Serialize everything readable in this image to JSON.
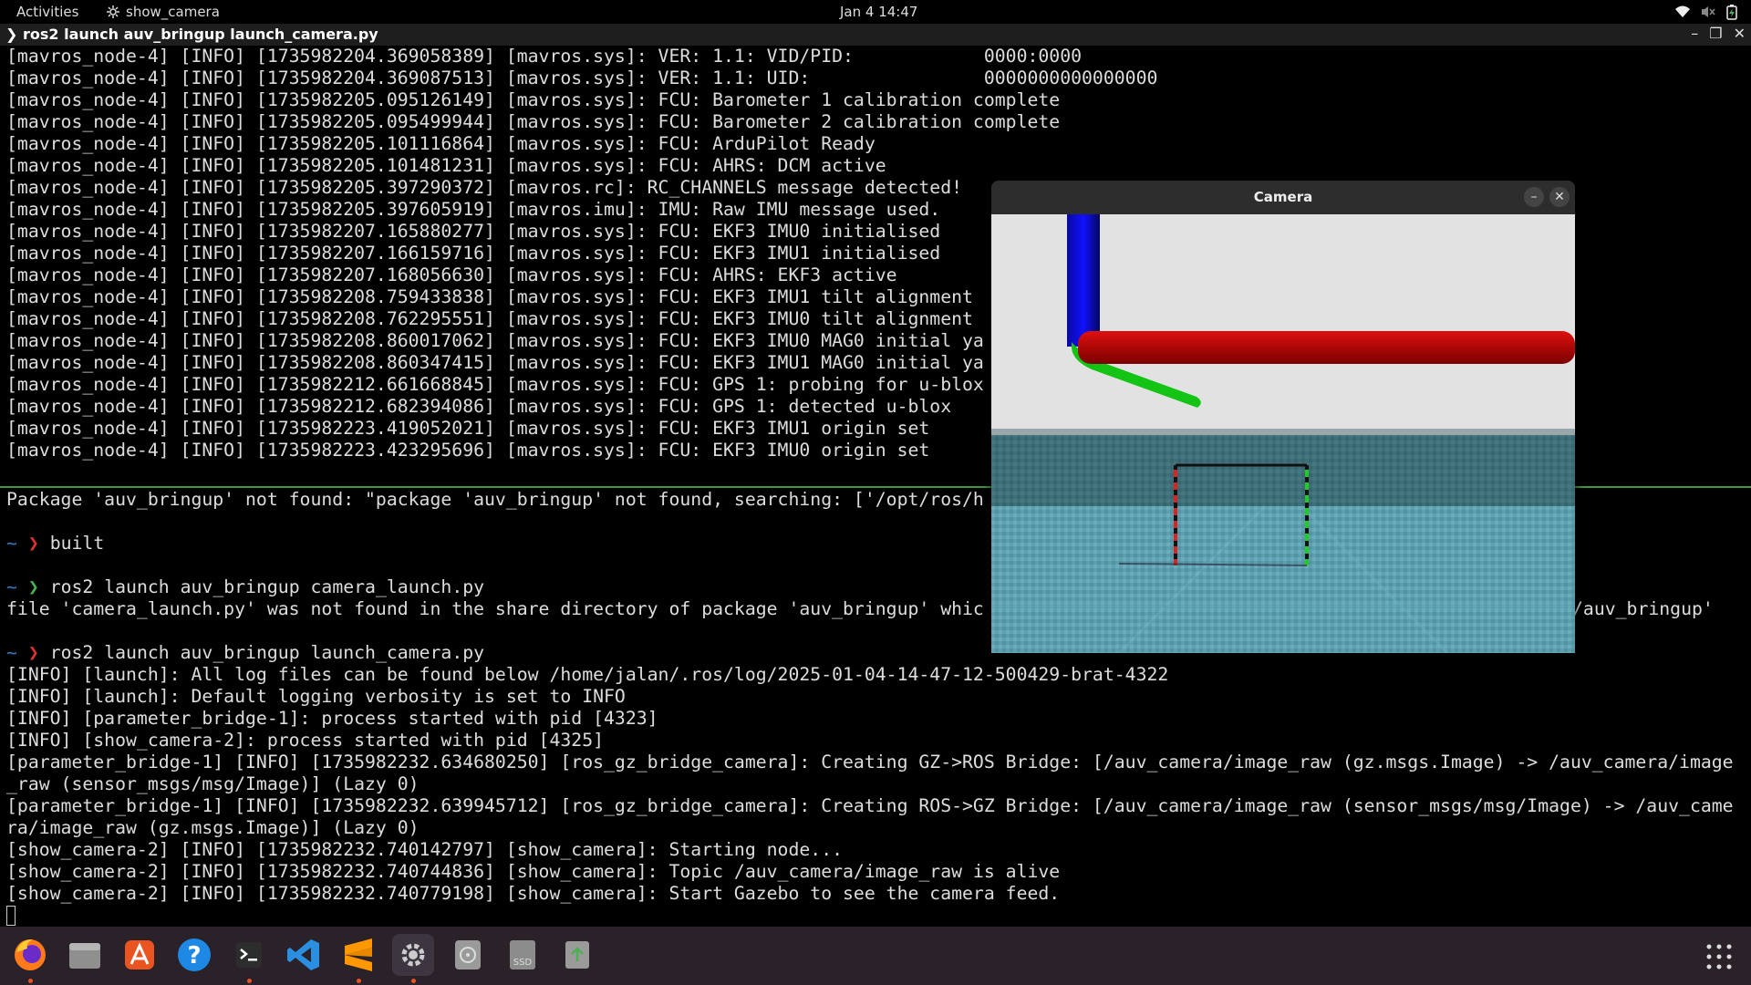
{
  "topbar": {
    "activities": "Activities",
    "app_name": "show_camera",
    "clock": "Jan 4  14:47"
  },
  "terminal": {
    "title": "ros2 launch auv_bringup launch_camera.py",
    "upper_lines": [
      "[mavros_node-4] [INFO] [1735982204.369058389] [mavros.sys]: VER: 1.1: VID/PID:            0000:0000",
      "[mavros_node-4] [INFO] [1735982204.369087513] [mavros.sys]: VER: 1.1: UID:                0000000000000000",
      "[mavros_node-4] [INFO] [1735982205.095126149] [mavros.sys]: FCU: Barometer 1 calibration complete",
      "[mavros_node-4] [INFO] [1735982205.095499944] [mavros.sys]: FCU: Barometer 2 calibration complete",
      "[mavros_node-4] [INFO] [1735982205.101116864] [mavros.sys]: FCU: ArduPilot Ready",
      "[mavros_node-4] [INFO] [1735982205.101481231] [mavros.sys]: FCU: AHRS: DCM active",
      "[mavros_node-4] [INFO] [1735982205.397290372] [mavros.rc]: RC_CHANNELS message detected!",
      "[mavros_node-4] [INFO] [1735982205.397605919] [mavros.imu]: IMU: Raw IMU message used.",
      "[mavros_node-4] [INFO] [1735982207.165880277] [mavros.sys]: FCU: EKF3 IMU0 initialised",
      "[mavros_node-4] [INFO] [1735982207.166159716] [mavros.sys]: FCU: EKF3 IMU1 initialised",
      "[mavros_node-4] [INFO] [1735982207.168056630] [mavros.sys]: FCU: AHRS: EKF3 active",
      "[mavros_node-4] [INFO] [1735982208.759433838] [mavros.sys]: FCU: EKF3 IMU1 tilt alignment",
      "[mavros_node-4] [INFO] [1735982208.762295551] [mavros.sys]: FCU: EKF3 IMU0 tilt alignment",
      "[mavros_node-4] [INFO] [1735982208.860017062] [mavros.sys]: FCU: EKF3 IMU0 MAG0 initial ya",
      "[mavros_node-4] [INFO] [1735982208.860347415] [mavros.sys]: FCU: EKF3 IMU1 MAG0 initial ya",
      "[mavros_node-4] [INFO] [1735982212.661668845] [mavros.sys]: FCU: GPS 1: probing for u-blox",
      "[mavros_node-4] [INFO] [1735982212.682394086] [mavros.sys]: FCU: GPS 1: detected u-blox",
      "[mavros_node-4] [INFO] [1735982223.419052021] [mavros.sys]: FCU: EKF3 IMU1 origin set",
      "[mavros_node-4] [INFO] [1735982223.423295696] [mavros.sys]: FCU: EKF3 IMU0 origin set"
    ],
    "package_error": "Package 'auv_bringup' not found: \"package 'auv_bringup' not found, searching: ['/opt/ros/h",
    "prompt_tilde": "~",
    "prompt_arrow": "❯",
    "cmd_built": "built",
    "cmd_camera_launch": "ros2 launch auv_bringup camera_launch.py",
    "file_error_left": "file 'camera_launch.py' was not found in the share directory of package 'auv_bringup' whic",
    "file_error_right": "/auv_bringup'",
    "cmd_launch_camera": "ros2 launch auv_bringup launch_camera.py",
    "lower_lines": [
      "[INFO] [launch]: All log files can be found below /home/jalan/.ros/log/2025-01-04-14-47-12-500429-brat-4322",
      "[INFO] [launch]: Default logging verbosity is set to INFO",
      "[INFO] [parameter_bridge-1]: process started with pid [4323]",
      "[INFO] [show_camera-2]: process started with pid [4325]",
      "[parameter_bridge-1] [INFO] [1735982232.634680250] [ros_gz_bridge_camera]: Creating GZ->ROS Bridge: [/auv_camera/image_raw (gz.msgs.Image) -> /auv_camera/image",
      "_raw (sensor_msgs/msg/Image)] (Lazy 0)",
      "[parameter_bridge-1] [INFO] [1735982232.639945712] [ros_gz_bridge_camera]: Creating ROS->GZ Bridge: [/auv_camera/image_raw (sensor_msgs/msg/Image) -> /auv_came",
      "ra/image_raw (gz.msgs.Image)] (Lazy 0)",
      "[show_camera-2] [INFO] [1735982232.740142797] [show_camera]: Starting node...",
      "[show_camera-2] [INFO] [1735982232.740744836] [show_camera]: Topic /auv_camera/image_raw is alive",
      "[show_camera-2] [INFO] [1735982232.740779198] [show_camera]: Start Gazebo to see the camera feed."
    ]
  },
  "camera_window": {
    "title": "Camera",
    "minimize": "–",
    "close": "✕"
  },
  "dock": {
    "items": [
      "firefox-icon",
      "files-icon",
      "app-center-icon",
      "help-icon",
      "terminal-icon",
      "vscode-icon",
      "sublime-icon",
      "settings-icon",
      "disks-icon",
      "ssd-icon",
      "trash-icon"
    ],
    "ssd_label": "SSD"
  },
  "colors": {
    "accent": "#e95420",
    "terminal_bg": "#000000",
    "separator": "#3c9b3c",
    "dock_bg": "#2a2129"
  }
}
